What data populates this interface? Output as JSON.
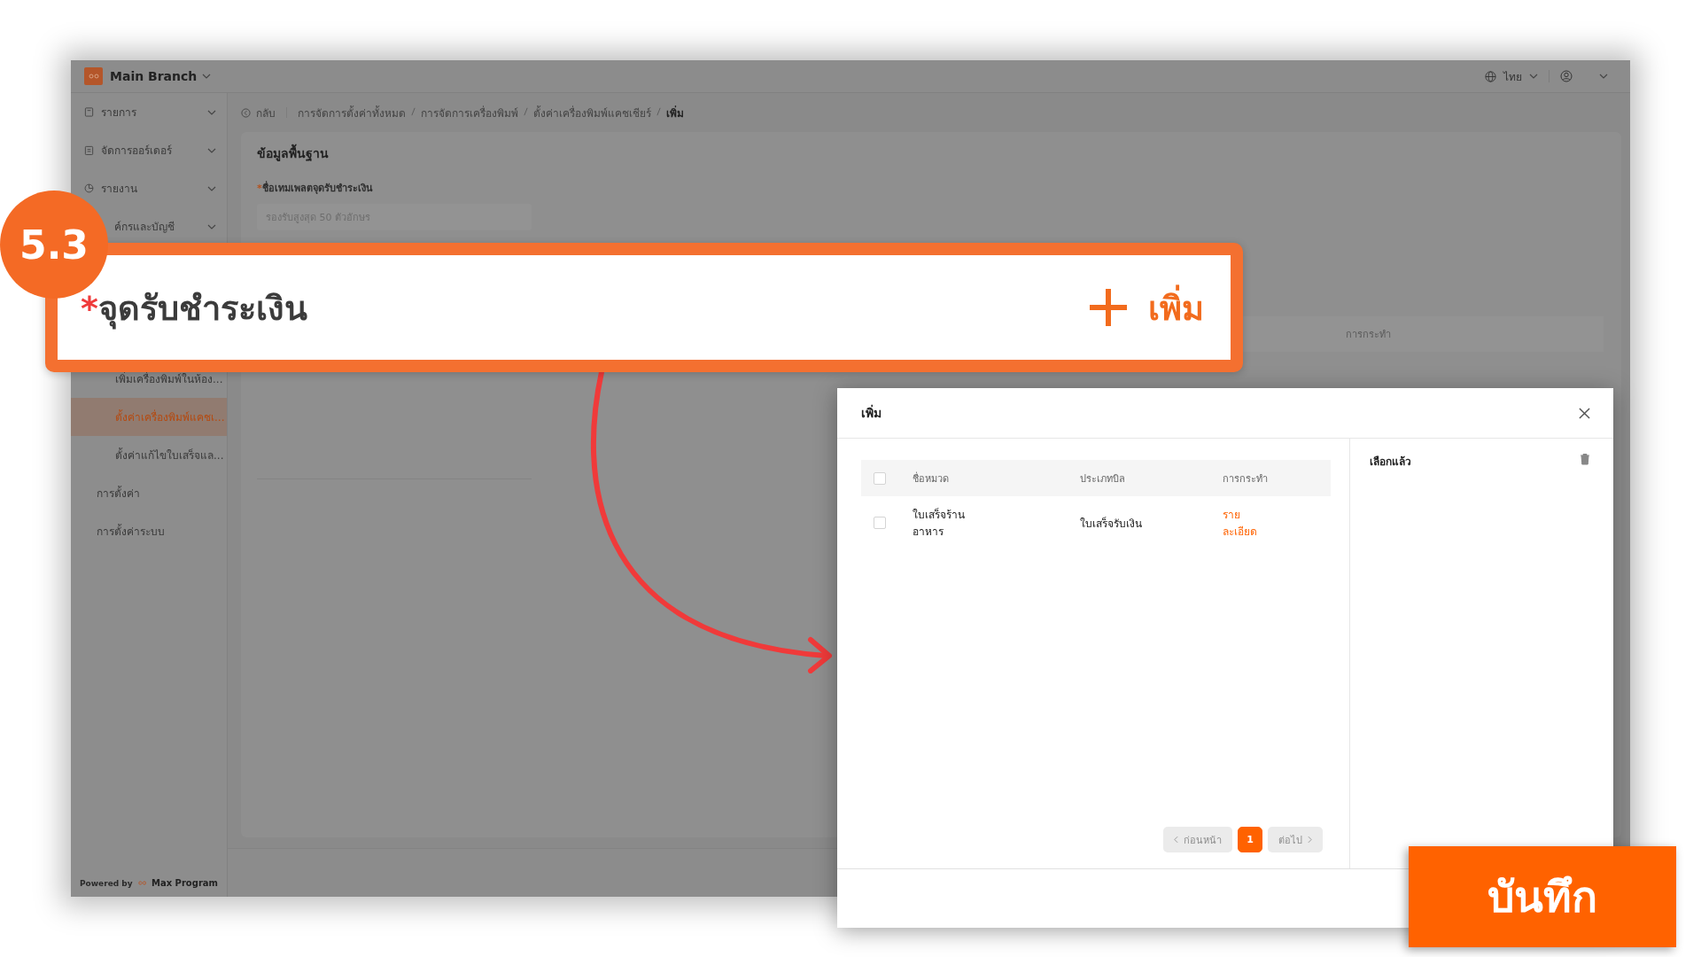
{
  "app": {
    "branch": "Main Branch",
    "language": "ไทย"
  },
  "sidebar": {
    "items": [
      {
        "label": "รายการ"
      },
      {
        "label": "จัดการออร์เดอร์"
      },
      {
        "label": "รายงาน"
      },
      {
        "label": "ค์กรและบัญชี"
      }
    ],
    "sub_items": [
      {
        "label": "เพิ่มเครื่องพิมพ์ในห้อง...",
        "selected": false
      },
      {
        "label": "ตั้งค่าเครื่องพิมพ์แคชเ...",
        "selected": true
      },
      {
        "label": "ตั้งค่าแก้ไขใบเสร็จแล...",
        "selected": false
      }
    ],
    "bottom_items": [
      {
        "label": "การตั้งค่า"
      },
      {
        "label": "การตั้งค่าระบบ"
      }
    ],
    "powered_by": "Powered by",
    "brand": "Max Program"
  },
  "breadcrumb": {
    "back": "กลับ",
    "path": [
      "การจัดการตั้งค่าทั้งหมด",
      "การจัดการเครื่องพิมพ์",
      "ตั้งค่าเครื่องพิมพ์แคชเชียร์",
      "เพิ่ม"
    ]
  },
  "form": {
    "section_title": "ข้อมูลพื้นฐาน",
    "required_mark": "*",
    "field_label": "ชื่อเทมเพลตจุดรับชำระเงิน",
    "placeholder": "รองรับสูงสุด 50 ตัวอักษร",
    "table_action_header": "การกระทำ"
  },
  "callout": {
    "step": "5.3",
    "required_mark": "*",
    "label": "จุดรับชำระเงิน",
    "add_label": "เพิ่ม"
  },
  "modal": {
    "title": "เพิ่ม",
    "header_checked": false,
    "columns": [
      "ชื่อหมวด",
      "ประเภทบิล",
      "การกระทำ"
    ],
    "rows": [
      {
        "checked": false,
        "name": "ใบเสร็จร้านอาหาร",
        "bill_type": "ใบเสร็จรับเงิน",
        "action": "รายละเอียด"
      }
    ],
    "pagination": {
      "prev": {
        "label": "ก่อนหน้า",
        "disabled": true
      },
      "pages": [
        {
          "label": "1",
          "selected": true
        }
      ],
      "next": {
        "label": "ต่อไป",
        "disabled": true
      }
    },
    "selected_title": "เลือกแล้ว"
  },
  "save_button": "บันทึก"
}
